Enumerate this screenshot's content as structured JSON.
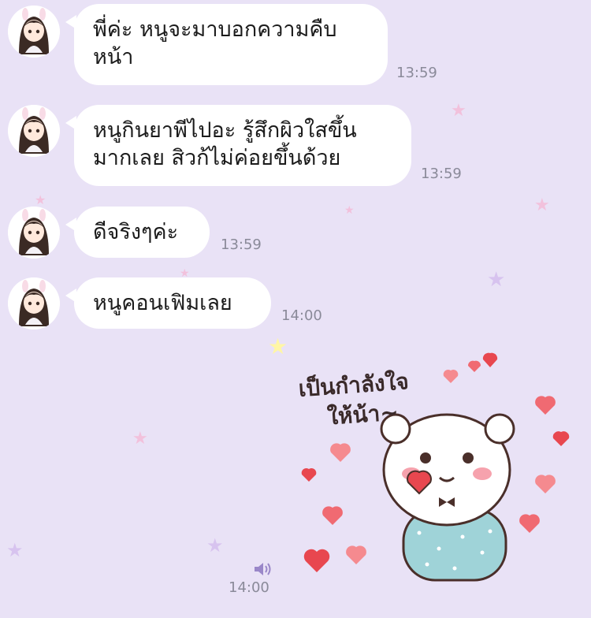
{
  "colors": {
    "background": "#e9e2f6",
    "bubble": "#ffffff",
    "timestamp": "#8a8a99",
    "star_pink": "#f2c1dc",
    "star_lavender": "#d7c3ef",
    "star_yellow": "#fff6a6"
  },
  "messages": [
    {
      "lines": [
        "พี่ค่ะ หนูจะมาบอกความคืบ",
        "หน้า"
      ],
      "time": "13:59",
      "avatar_icon": "girl-avatar-icon"
    },
    {
      "lines": [
        "หนูกินยาพีไปอะ รู้สึกผิวใสขึ้น",
        "มากเลย สิวก้ไม่ค่อยขึ้นด้วย"
      ],
      "time": "13:59",
      "avatar_icon": "girl-avatar-icon"
    },
    {
      "lines": [
        "ดีจริงๆค่ะ"
      ],
      "time": "13:59",
      "avatar_icon": "girl-avatar-icon"
    },
    {
      "lines": [
        "หนูคอนเฟิมเลย"
      ],
      "time": "14:00",
      "avatar_icon": "girl-avatar-icon"
    }
  ],
  "sticker": {
    "icon": "bear-heart-sticker-icon",
    "caption_lines": [
      "เป็นกำลังใจ",
      "ให้น้า~"
    ],
    "sound_icon": "speaker-icon",
    "time": "14:00"
  }
}
